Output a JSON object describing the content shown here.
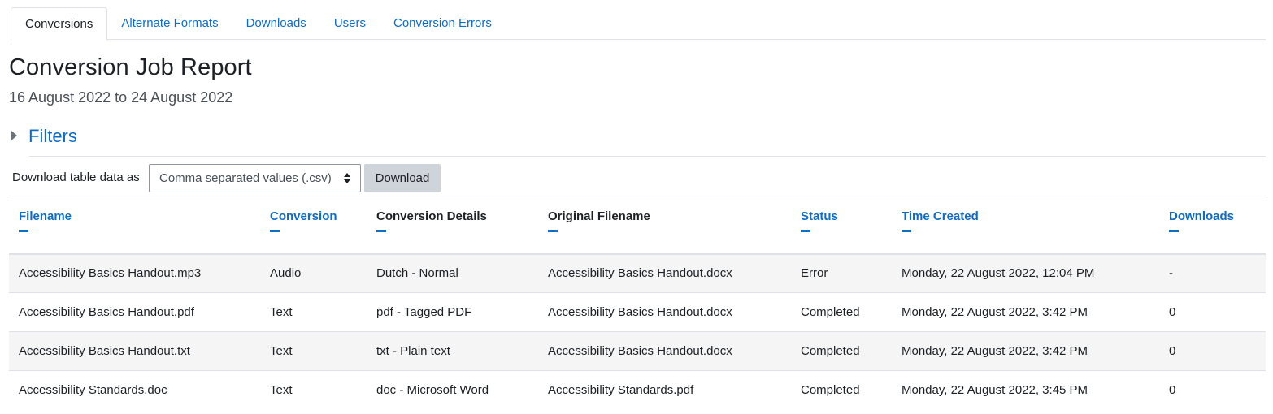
{
  "tabs": [
    {
      "label": "Conversions",
      "active": true
    },
    {
      "label": "Alternate Formats",
      "active": false
    },
    {
      "label": "Downloads",
      "active": false
    },
    {
      "label": "Users",
      "active": false
    },
    {
      "label": "Conversion Errors",
      "active": false
    }
  ],
  "page": {
    "title": "Conversion Job Report",
    "date_range": "16 August 2022 to 24 August 2022"
  },
  "filters": {
    "label": "Filters",
    "expanded": false
  },
  "download_form": {
    "label": "Download table data as",
    "selected_format": "Comma separated values (.csv)",
    "button_label": "Download"
  },
  "table": {
    "columns": [
      {
        "label": "Filename",
        "sortable": true
      },
      {
        "label": "Conversion",
        "sortable": true
      },
      {
        "label": "Conversion Details",
        "sortable": false
      },
      {
        "label": "Original Filename",
        "sortable": false
      },
      {
        "label": "Status",
        "sortable": true
      },
      {
        "label": "Time Created",
        "sortable": true
      },
      {
        "label": "Downloads",
        "sortable": true
      }
    ],
    "rows": [
      [
        "Accessibility Basics Handout.mp3",
        "Audio",
        "Dutch - Normal",
        "Accessibility Basics Handout.docx",
        "Error",
        "Monday, 22 August 2022, 12:04 PM",
        "-"
      ],
      [
        "Accessibility Basics Handout.pdf",
        "Text",
        "pdf - Tagged PDF",
        "Accessibility Basics Handout.docx",
        "Completed",
        "Monday, 22 August 2022, 3:42 PM",
        "0"
      ],
      [
        "Accessibility Basics Handout.txt",
        "Text",
        "txt - Plain text",
        "Accessibility Basics Handout.docx",
        "Completed",
        "Monday, 22 August 2022, 3:42 PM",
        "0"
      ],
      [
        "Accessibility Standards.doc",
        "Text",
        "doc - Microsoft Word",
        "Accessibility Standards.pdf",
        "Completed",
        "Monday, 22 August 2022, 3:45 PM",
        "0"
      ]
    ]
  },
  "colors": {
    "link": "#0f6cbf",
    "text": "#1d2125",
    "muted": "#495057",
    "button_bg": "#ced4da",
    "row_stripe": "#f5f5f5",
    "border": "#dee2e6"
  }
}
